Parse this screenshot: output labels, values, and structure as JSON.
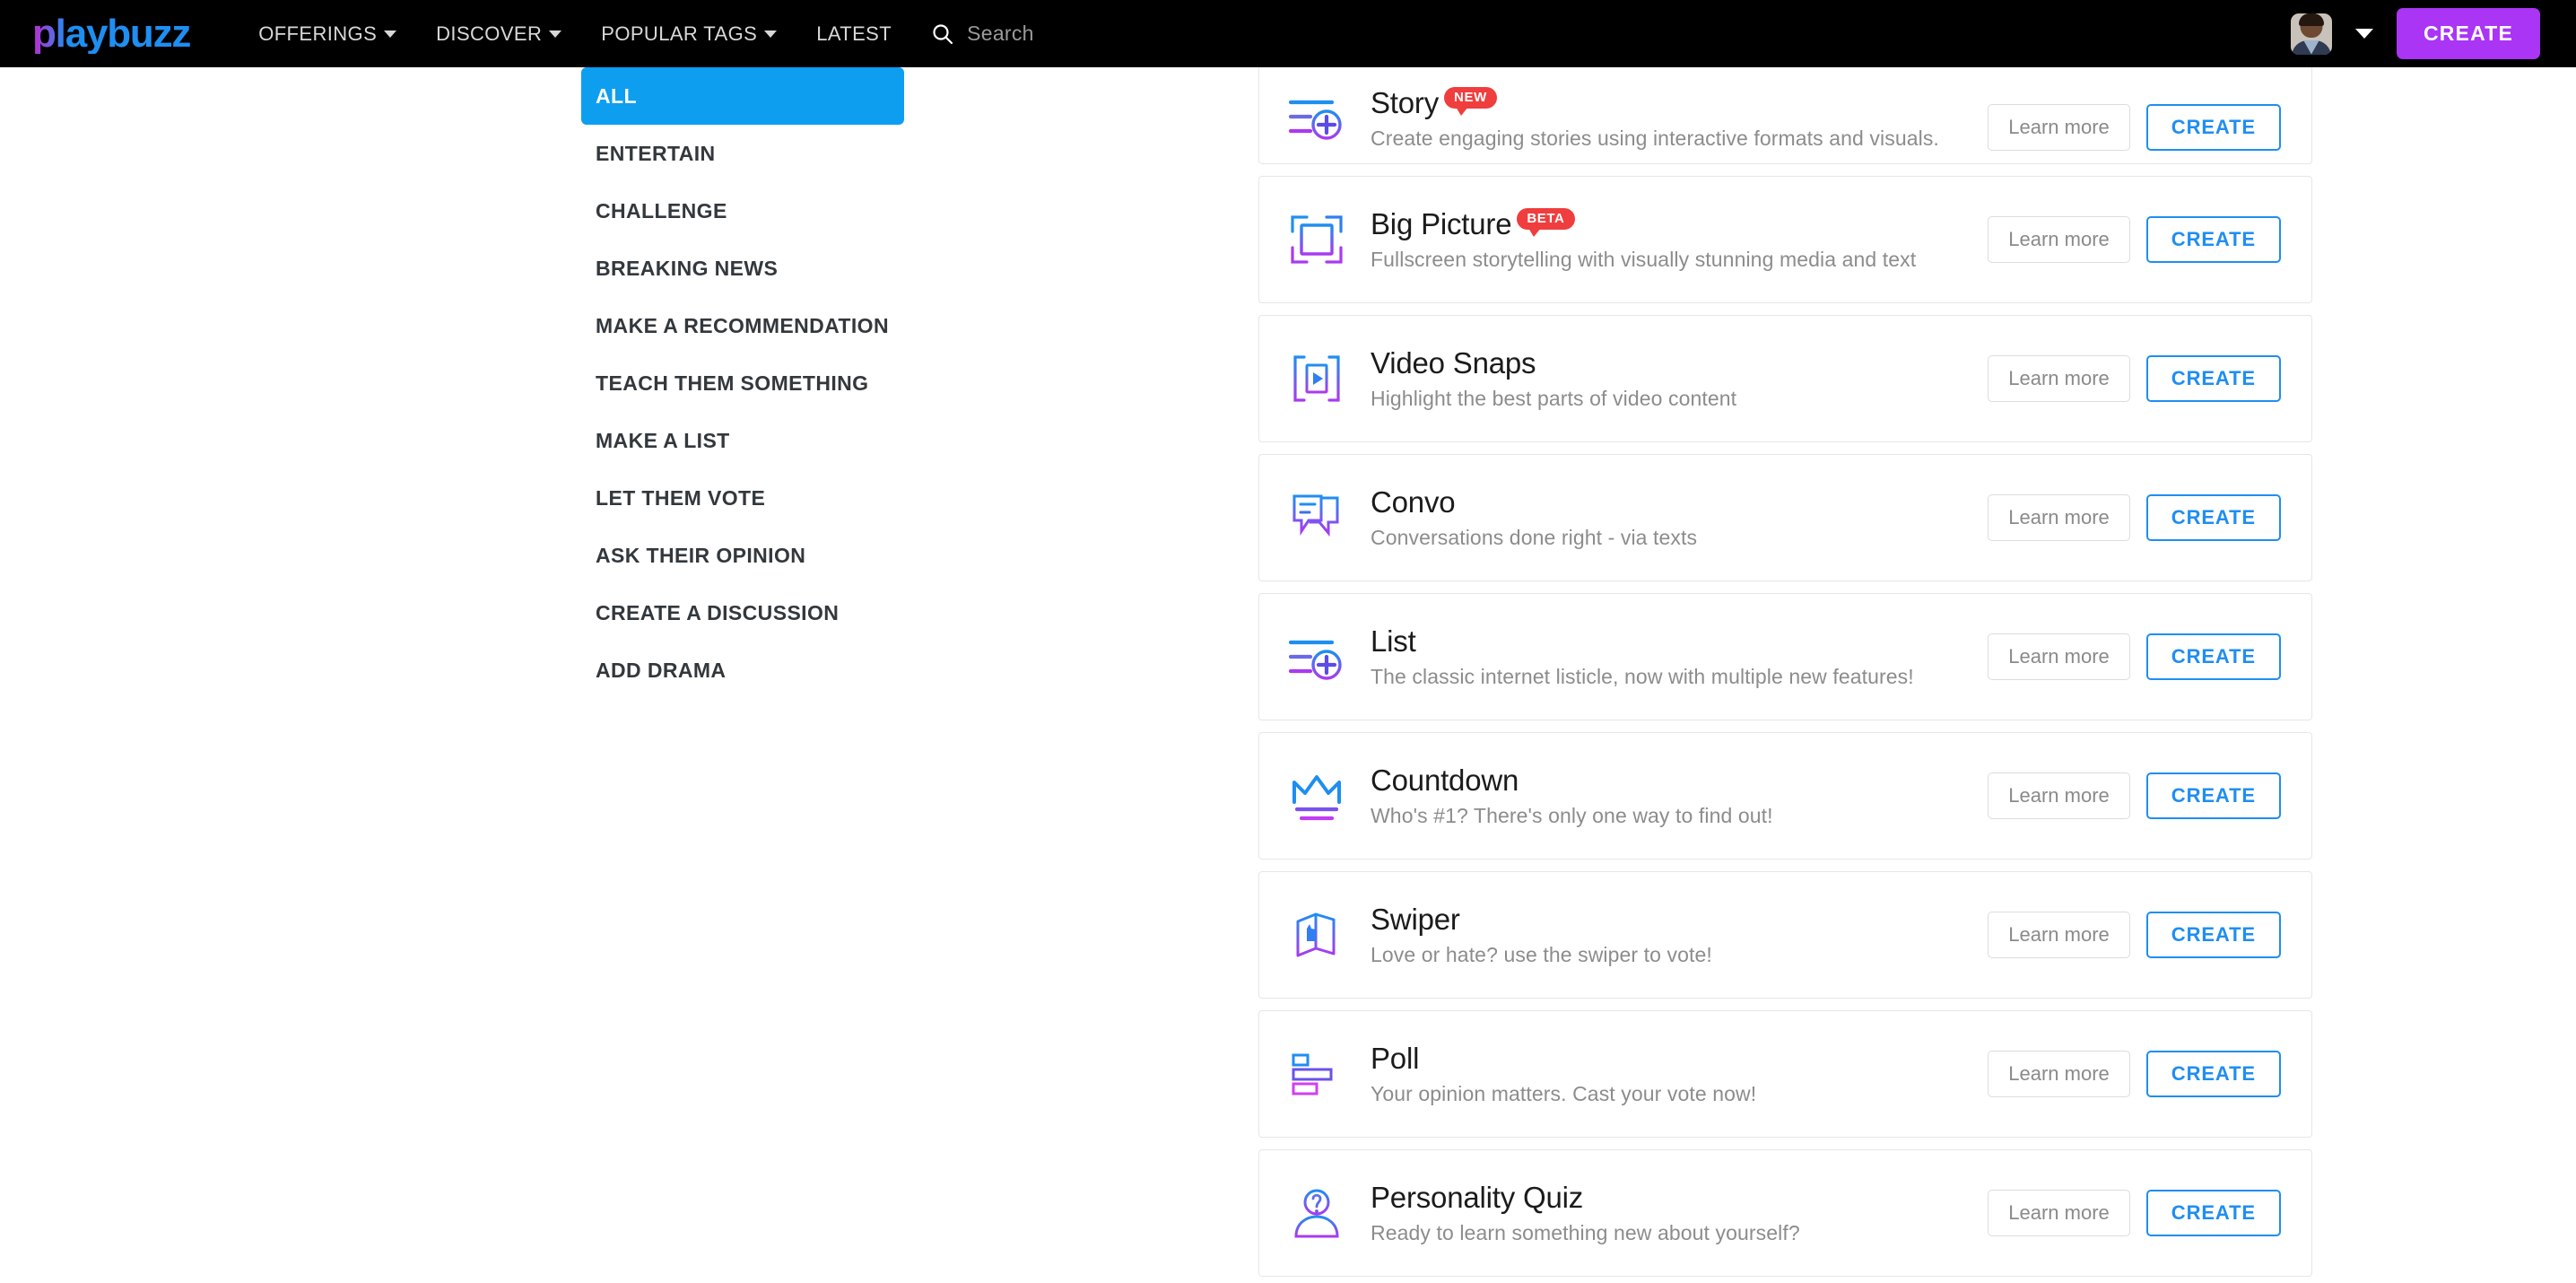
{
  "navbar": {
    "logo_text": "playbuzz",
    "links": [
      {
        "label": "OFFERINGS",
        "has_caret": true,
        "icon": "chevron-down-icon"
      },
      {
        "label": "DISCOVER",
        "has_caret": true,
        "icon": "chevron-down-icon"
      },
      {
        "label": "POPULAR TAGS",
        "has_caret": true,
        "icon": "chevron-down-icon"
      },
      {
        "label": "LATEST",
        "has_caret": false,
        "icon": ""
      }
    ],
    "search": {
      "icon": "search-icon",
      "placeholder": "Search",
      "value": ""
    },
    "avatar_icon": "user-avatar",
    "account_caret_icon": "chevron-down-icon",
    "create_label": "CREATE",
    "colors": {
      "background": "#000000",
      "create_button": "#aa35f5",
      "link_text": "#d8d8d8"
    }
  },
  "sidebar": {
    "items": [
      {
        "label": "ALL",
        "active": true
      },
      {
        "label": "ENTERTAIN",
        "active": false
      },
      {
        "label": "CHALLENGE",
        "active": false
      },
      {
        "label": "BREAKING NEWS",
        "active": false
      },
      {
        "label": "MAKE A RECOMMENDATION",
        "active": false
      },
      {
        "label": "TEACH THEM SOMETHING",
        "active": false
      },
      {
        "label": "MAKE A LIST",
        "active": false
      },
      {
        "label": "LET THEM VOTE",
        "active": false
      },
      {
        "label": "ASK THEIR OPINION",
        "active": false
      },
      {
        "label": "CREATE A DISCUSSION",
        "active": false
      },
      {
        "label": "ADD DRAMA",
        "active": false
      }
    ],
    "active_color": "#0d9ef0"
  },
  "main": {
    "learn_more_label": "Learn more",
    "create_label": "CREATE",
    "cards": [
      {
        "title": "Story",
        "badge": "NEW",
        "description": "Create engaging stories using interactive formats and visuals.",
        "icon": "list-plus-icon"
      },
      {
        "title": "Big Picture",
        "badge": "BETA",
        "description": "Fullscreen storytelling with visually stunning media and text",
        "icon": "frame-crop-icon"
      },
      {
        "title": "Video Snaps",
        "badge": "",
        "description": "Highlight the best parts of video content",
        "icon": "video-play-brackets-icon"
      },
      {
        "title": "Convo",
        "badge": "",
        "description": "Conversations done right - via texts",
        "icon": "chat-bubbles-icon"
      },
      {
        "title": "List",
        "badge": "",
        "description": "The classic internet listicle, now with multiple new features!",
        "icon": "list-plus-icon"
      },
      {
        "title": "Countdown",
        "badge": "",
        "description": "Who's #1? There's only one way to find out!",
        "icon": "crown-icon"
      },
      {
        "title": "Swiper",
        "badge": "",
        "description": "Love or hate? use the swiper to vote!",
        "icon": "swipe-cards-thumb-icon"
      },
      {
        "title": "Poll",
        "badge": "",
        "description": "Your opinion matters. Cast your vote now!",
        "icon": "poll-bars-icon"
      },
      {
        "title": "Personality Quiz",
        "badge": "",
        "description": "Ready to learn something new about yourself?",
        "icon": "person-question-icon"
      }
    ],
    "colors": {
      "card_border": "#e6e6e6",
      "title": "#1b1b1b",
      "description": "#8c8c8c",
      "badge": "#f03d3d",
      "create_border": "#1f8ef1"
    }
  }
}
